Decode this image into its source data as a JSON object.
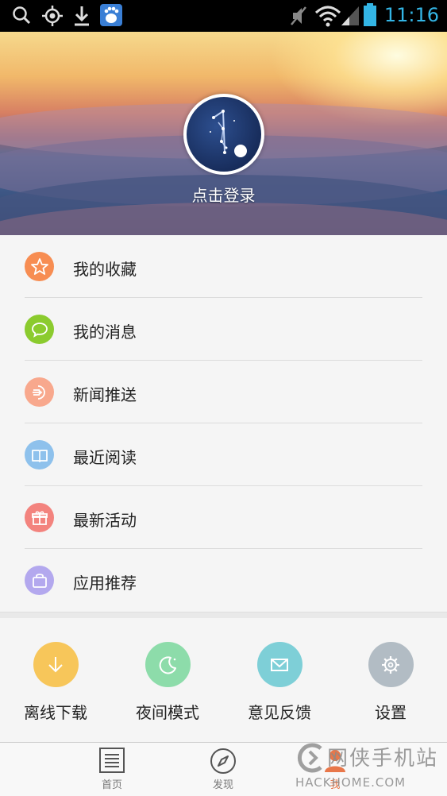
{
  "status_bar": {
    "time": "11:16",
    "icons": [
      "search-icon",
      "gps-icon",
      "download-icon",
      "baidu-icon",
      "mute-icon",
      "wifi-icon",
      "signal-icon",
      "battery-icon"
    ],
    "time_color": "#33b5e5"
  },
  "header": {
    "login_text": "点击登录",
    "avatar_icon": "app-logo-icon"
  },
  "menu": {
    "items": [
      {
        "label": "我的收藏",
        "icon": "star-icon",
        "color": "#f78d52"
      },
      {
        "label": "我的消息",
        "icon": "chat-bubble-icon",
        "color": "#8bcb2e"
      },
      {
        "label": "新闻推送",
        "icon": "push-icon",
        "color": "#f8a88d"
      },
      {
        "label": "最近阅读",
        "icon": "book-icon",
        "color": "#8ec1ec"
      },
      {
        "label": "最新活动",
        "icon": "gift-icon",
        "color": "#f3837e"
      },
      {
        "label": "应用推荐",
        "icon": "bag-icon",
        "color": "#b3a8ee"
      }
    ]
  },
  "quick_actions": [
    {
      "label": "离线下载",
      "icon": "download-arrow-icon",
      "color": "#f7c65a"
    },
    {
      "label": "夜间模式",
      "icon": "moon-icon",
      "color": "#8ddcaa"
    },
    {
      "label": "意见反馈",
      "icon": "mail-icon",
      "color": "#7ecfd7"
    },
    {
      "label": "设置",
      "icon": "gear-icon",
      "color": "#b2bcc4"
    }
  ],
  "bottom_nav": [
    {
      "label": "首页",
      "icon": "document-icon"
    },
    {
      "label": "发现",
      "icon": "compass-icon"
    },
    {
      "label": "我",
      "icon": "person-icon"
    }
  ],
  "watermark": {
    "line1": "网侠手机站",
    "line2": "HACKHOME.COM"
  }
}
